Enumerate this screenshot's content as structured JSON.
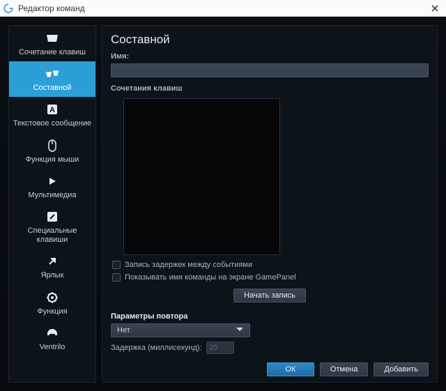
{
  "titlebar": {
    "title": "Редактор команд"
  },
  "sidebar": {
    "items": [
      {
        "label": "Сочетание клавиш"
      },
      {
        "label": "Составной"
      },
      {
        "label": "Текстовое сообщение"
      },
      {
        "label": "Функция мыши"
      },
      {
        "label": "Мультимедиа"
      },
      {
        "label": "Специальные клавиши"
      },
      {
        "label": "Ярлык"
      },
      {
        "label": "Функция"
      },
      {
        "label": "Ventrilo"
      }
    ]
  },
  "main": {
    "heading": "Составной",
    "name_label": "Имя:",
    "name_value": "",
    "keys_label": "Сочетания клавиш",
    "chk_record_delays": "Запись задержек между событиями",
    "chk_show_name": "Показывать имя команды на экране GamePanel",
    "start_record": "Начать запись",
    "repeat_label": "Параметры повтора",
    "repeat_value": "Нет",
    "delay_label": "Задержка (миллисекунд):",
    "delay_value": "25"
  },
  "footer": {
    "ok": "ОК",
    "cancel": "Отмена",
    "add": "Добавить"
  }
}
